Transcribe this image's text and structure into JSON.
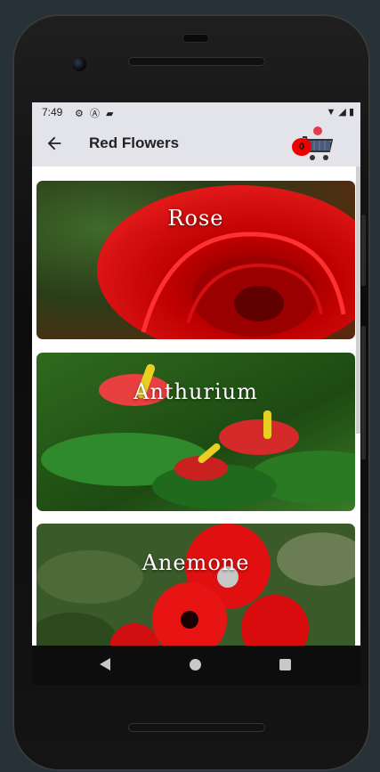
{
  "status_bar": {
    "time": "7:49",
    "left_icons": [
      "gear-icon",
      "a-icon",
      "sd-card-icon"
    ],
    "right_icons": [
      "wifi-icon",
      "signal-icon",
      "battery-icon"
    ]
  },
  "app_bar": {
    "title": "Red Flowers",
    "back_icon": "arrow-back-icon",
    "cart": {
      "icon": "shopping-cart-icon",
      "count": "0"
    }
  },
  "flowers": [
    {
      "name": "Rose"
    },
    {
      "name": "Anthurium"
    },
    {
      "name": "Anemone"
    }
  ],
  "nav_bar": {
    "icons": [
      "back-triangle-icon",
      "home-circle-icon",
      "recents-square-icon"
    ]
  },
  "colors": {
    "accent_red": "#e00000",
    "app_bar_bg": "#e3e3ea"
  }
}
